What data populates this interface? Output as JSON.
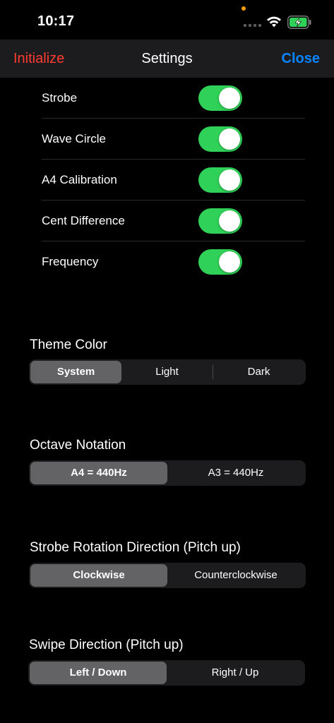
{
  "status": {
    "time": "10:17",
    "dot_color": "#ff9f0a",
    "battery_color": "#30d158"
  },
  "nav": {
    "left_label": "Initialize",
    "left_color": "#ff3b30",
    "title": "Settings",
    "right_label": "Close",
    "right_color": "#0a84ff"
  },
  "toggles": [
    {
      "label": "Strobe",
      "on": true
    },
    {
      "label": "Wave Circle",
      "on": true
    },
    {
      "label": "A4 Calibration",
      "on": true
    },
    {
      "label": "Cent Difference",
      "on": true
    },
    {
      "label": "Frequency",
      "on": true
    }
  ],
  "switch_on_color": "#30d158",
  "theme": {
    "title": "Theme Color",
    "options": [
      "System",
      "Light",
      "Dark"
    ],
    "selected": "System"
  },
  "octave": {
    "title": "Octave Notation",
    "options": [
      "A4 = 440Hz",
      "A3 = 440Hz"
    ],
    "selected": "A4 = 440Hz"
  },
  "strobe_direction": {
    "title": "Strobe Rotation Direction (Pitch up)",
    "options": [
      "Clockwise",
      "Counterclockwise"
    ],
    "selected": "Clockwise"
  },
  "swipe_direction": {
    "title": "Swipe Direction (Pitch up)",
    "options": [
      "Left / Down",
      "Right / Up"
    ],
    "selected": "Left / Down"
  }
}
